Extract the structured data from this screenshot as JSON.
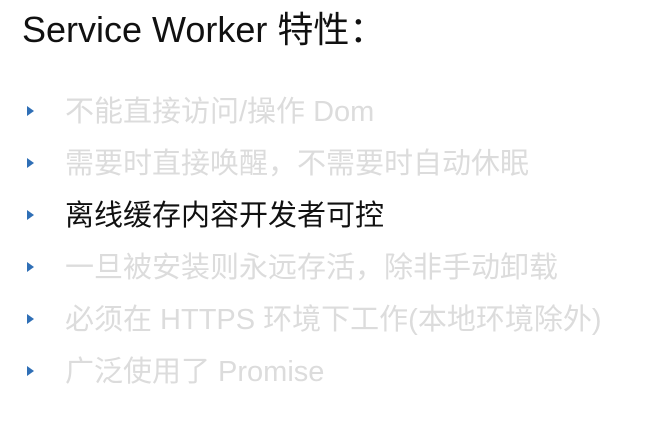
{
  "slide": {
    "title": "Service Worker 特性：",
    "accent_color": "#2f6fb6",
    "dim_text_color": "#dcdcdc",
    "active_text_color": "#111111",
    "bullets": [
      {
        "text": "不能直接访问/操作 Dom",
        "active": false
      },
      {
        "text": "需要时直接唤醒，不需要时自动休眠",
        "active": false
      },
      {
        "text": "离线缓存内容开发者可控",
        "active": true
      },
      {
        "text": "一旦被安装则永远存活，除非手动卸载",
        "active": false
      },
      {
        "text": "必须在 HTTPS 环境下工作(本地环境除外)",
        "active": false
      },
      {
        "text": "广泛使用了 Promise",
        "active": false
      }
    ]
  }
}
